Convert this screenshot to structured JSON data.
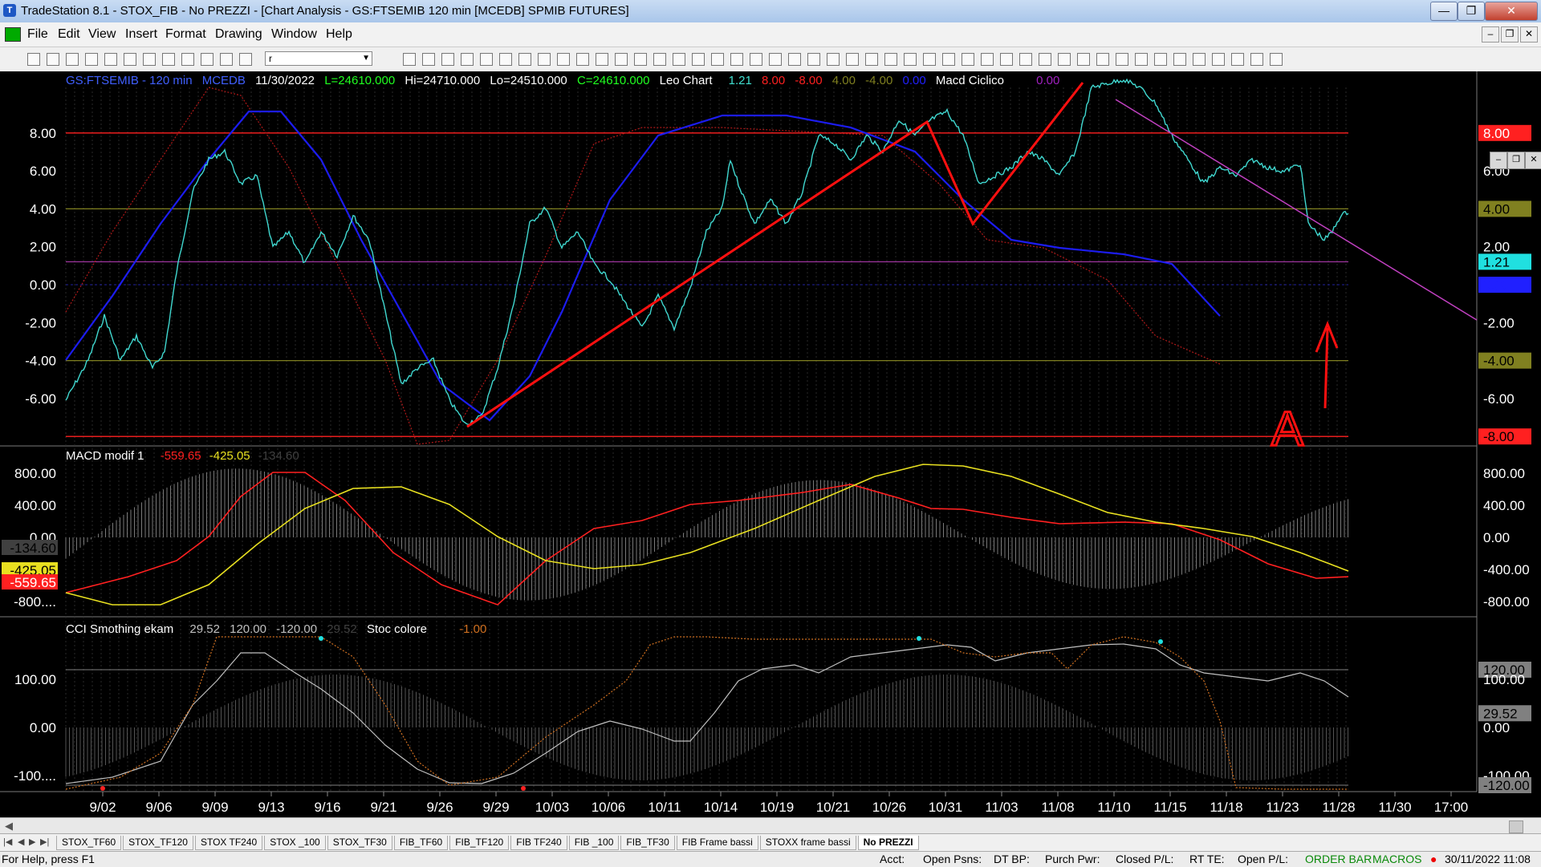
{
  "window": {
    "title": "TradeStation 8.1 - STOX_FIB - No PREZZI - [Chart Analysis - GS:FTSEMIB  120 min  [MCEDB] SPMIB FUTURES]",
    "buttons": {
      "minimize": "—",
      "restore": "❐",
      "close": "✕"
    },
    "mdi_buttons": {
      "minimize": "–",
      "restore": "❐",
      "close": "✕"
    }
  },
  "menu": [
    "File",
    "Edit",
    "View",
    "Insert",
    "Format",
    "Drawing",
    "Window",
    "Help"
  ],
  "toolbar": {
    "symbol_value": "r"
  },
  "chart_header": {
    "symbol": "GS:FTSEMIB - 120 min",
    "source": "MCEDB",
    "date": "11/30/2022",
    "last": "L=24610.000",
    "high": "Hi=24710.000",
    "low": "Lo=24510.000",
    "close": "C=24610.000",
    "study1": "Leo Chart",
    "study1_values": [
      "1.21",
      "8.00",
      "-8.00",
      "4.00",
      "-4.00",
      "0.00"
    ],
    "study2": "Macd Ciclico",
    "study2_value": "0.00"
  },
  "macd_header": {
    "name": "MACD modif 1",
    "values": [
      "-559.65",
      "-425.05",
      "-134.60"
    ]
  },
  "cci_header": {
    "name": "CCI Smothing ekam",
    "values": [
      "29.52",
      "120.00",
      "-120.00",
      "29.52"
    ],
    "name2": "Stoc colore",
    "value2": "-1.00"
  },
  "axes": {
    "price_ticks": [
      "8.00",
      "6.00",
      "4.00",
      "2.00",
      "0.00",
      "-2.00",
      "-4.00",
      "-6.00"
    ],
    "price_right_ticks": [
      "8.00",
      "6.00",
      "4.00",
      "2.00",
      "1.21",
      "0.00",
      "-2.00",
      "-4.00",
      "-6.00",
      "-8.00"
    ],
    "macd_ticks": [
      "800.00",
      "400.00",
      "0.00",
      "-400.00",
      "-800.00"
    ],
    "macd_left_ticks": [
      "800.00",
      "400.00",
      "0.00",
      "-134.60",
      "-425.05",
      "-559.65",
      "-800...."
    ],
    "cci_ticks": [
      "120.00",
      "100.00",
      "29.52",
      "0.00",
      "-100.00",
      "-120.00"
    ],
    "cci_left_ticks": [
      "100.00",
      "0.00",
      "-100...."
    ],
    "dates": [
      "9/02",
      "9/06",
      "9/09",
      "9/13",
      "9/16",
      "9/21",
      "9/26",
      "9/29",
      "10/03",
      "10/06",
      "10/11",
      "10/14",
      "10/19",
      "10/21",
      "10/26",
      "10/31",
      "11/03",
      "11/08",
      "11/10",
      "11/15",
      "11/18",
      "11/23",
      "11/28",
      "11/30",
      "17:00"
    ]
  },
  "colors": {
    "cyan": "#40d8d0",
    "blue": "#1c1cf0",
    "red": "#ff2020",
    "darkred": "#b01818",
    "yellow": "#e8e020",
    "olive": "#808020",
    "magenta": "#c040c0",
    "orange": "#d07020",
    "grey": "#c0c0c0"
  },
  "annotation": {
    "letter": "A"
  },
  "tabs": [
    "STOX_TF60",
    "STOX_TF120",
    "STOX TF240",
    "STOX _100",
    "STOX_TF30",
    "FIB_TF60",
    "FIB_TF120",
    "FIB TF240",
    "FIB _100",
    "FIB_TF30",
    "FIB Frame bassi",
    "STOXX frame bassi",
    "No PREZZI"
  ],
  "status": {
    "help": "For Help, press F1",
    "acct": "Acct:",
    "open_psns": "Open Psns:",
    "dt_bp": "DT BP:",
    "purch_pwr": "Purch Pwr:",
    "closed_pl": "Closed P/L:",
    "rt_te": "RT TE:",
    "open_pl": "Open P/L:",
    "order_bar": "ORDER BAR",
    "macros": "MACROS",
    "datetime": "30/11/2022 11:08"
  }
}
